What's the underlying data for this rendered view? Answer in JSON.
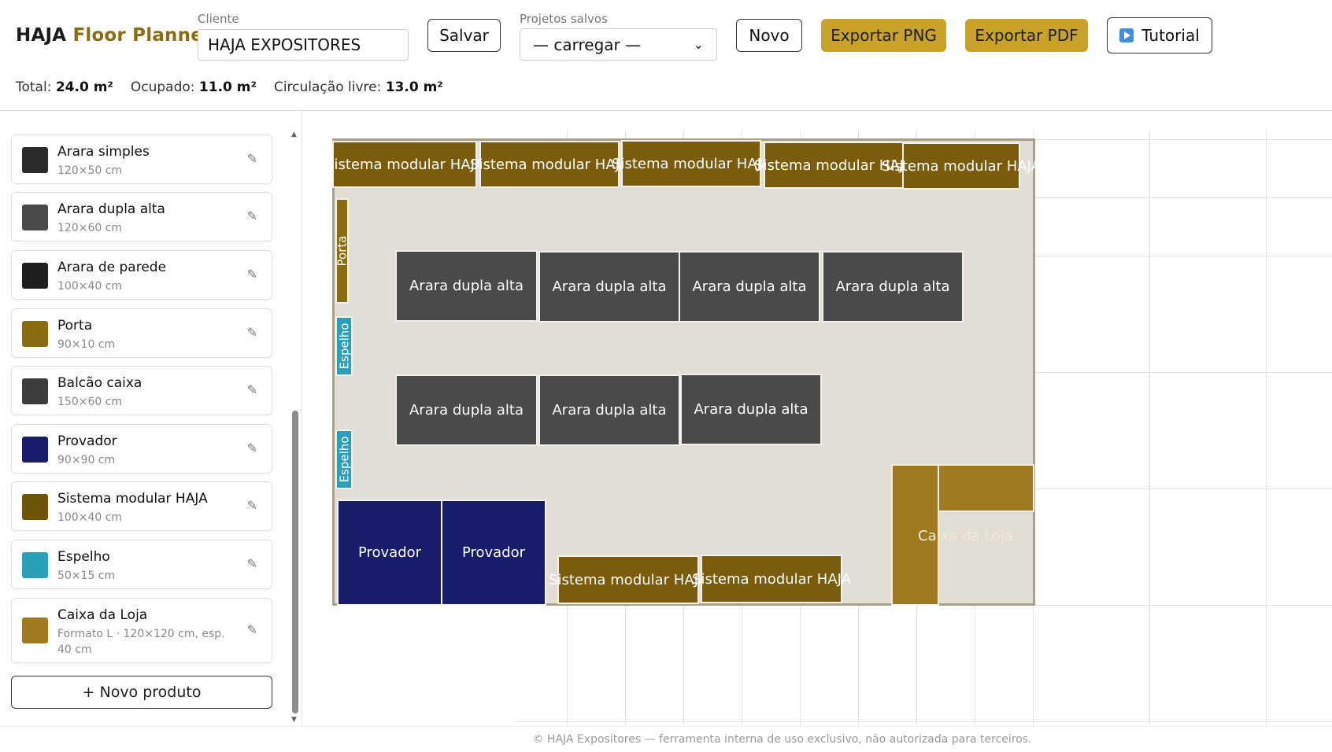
{
  "brand": {
    "part1": "HAJA",
    "part2": "Floor Planner"
  },
  "cliente": {
    "label": "Cliente",
    "value": "HAJA EXPOSITORES"
  },
  "toolbar": {
    "save_label": "Salvar",
    "projects_label": "Projetos salvos",
    "projects_selected": "— carregar —",
    "new_label": "Novo",
    "export_png_label": "Exportar PNG",
    "export_pdf_label": "Exportar PDF",
    "tutorial_label": "Tutorial"
  },
  "stats": {
    "total_label": "Total:",
    "total_value": "24.0 m²",
    "occupied_label": "Ocupado:",
    "occupied_value": "11.0 m²",
    "free_label": "Circulação livre:",
    "free_value": "13.0 m²"
  },
  "products": [
    {
      "name": "Arara simples",
      "dims": "120×50 cm",
      "color": "#2a2a2a"
    },
    {
      "name": "Arara dupla alta",
      "dims": "120×60 cm",
      "color": "#4a4a4a"
    },
    {
      "name": "Arara de parede",
      "dims": "100×40 cm",
      "color": "#1f1f1f"
    },
    {
      "name": "Porta",
      "dims": "90×10 cm",
      "color": "#8a6d12"
    },
    {
      "name": "Balcão caixa",
      "dims": "150×60 cm",
      "color": "#3c3c3c"
    },
    {
      "name": "Provador",
      "dims": "90×90 cm",
      "color": "#181d6b"
    },
    {
      "name": "Sistema modular HAJA",
      "dims": "100×40 cm",
      "color": "#6e5408"
    },
    {
      "name": "Espelho",
      "dims": "50×15 cm",
      "color": "#2aa0b8"
    },
    {
      "name": "Caixa da Loja",
      "dims": "Formato L · 120×120 cm, esp. 40 cm",
      "color": "#9f7a20"
    }
  ],
  "new_product_label": "+ Novo produto",
  "plan": {
    "modular_label": "Sistema modular HAJA",
    "rack_label": "Arara dupla alta",
    "door_label": "Porta",
    "mirror_label": "Espelho",
    "fitting_label": "Provador",
    "counter_label": "Caixa da Loja"
  },
  "footer": "© HAJA Expositores — ferramenta interna de uso exclusivo, não autorizada para terceiros."
}
